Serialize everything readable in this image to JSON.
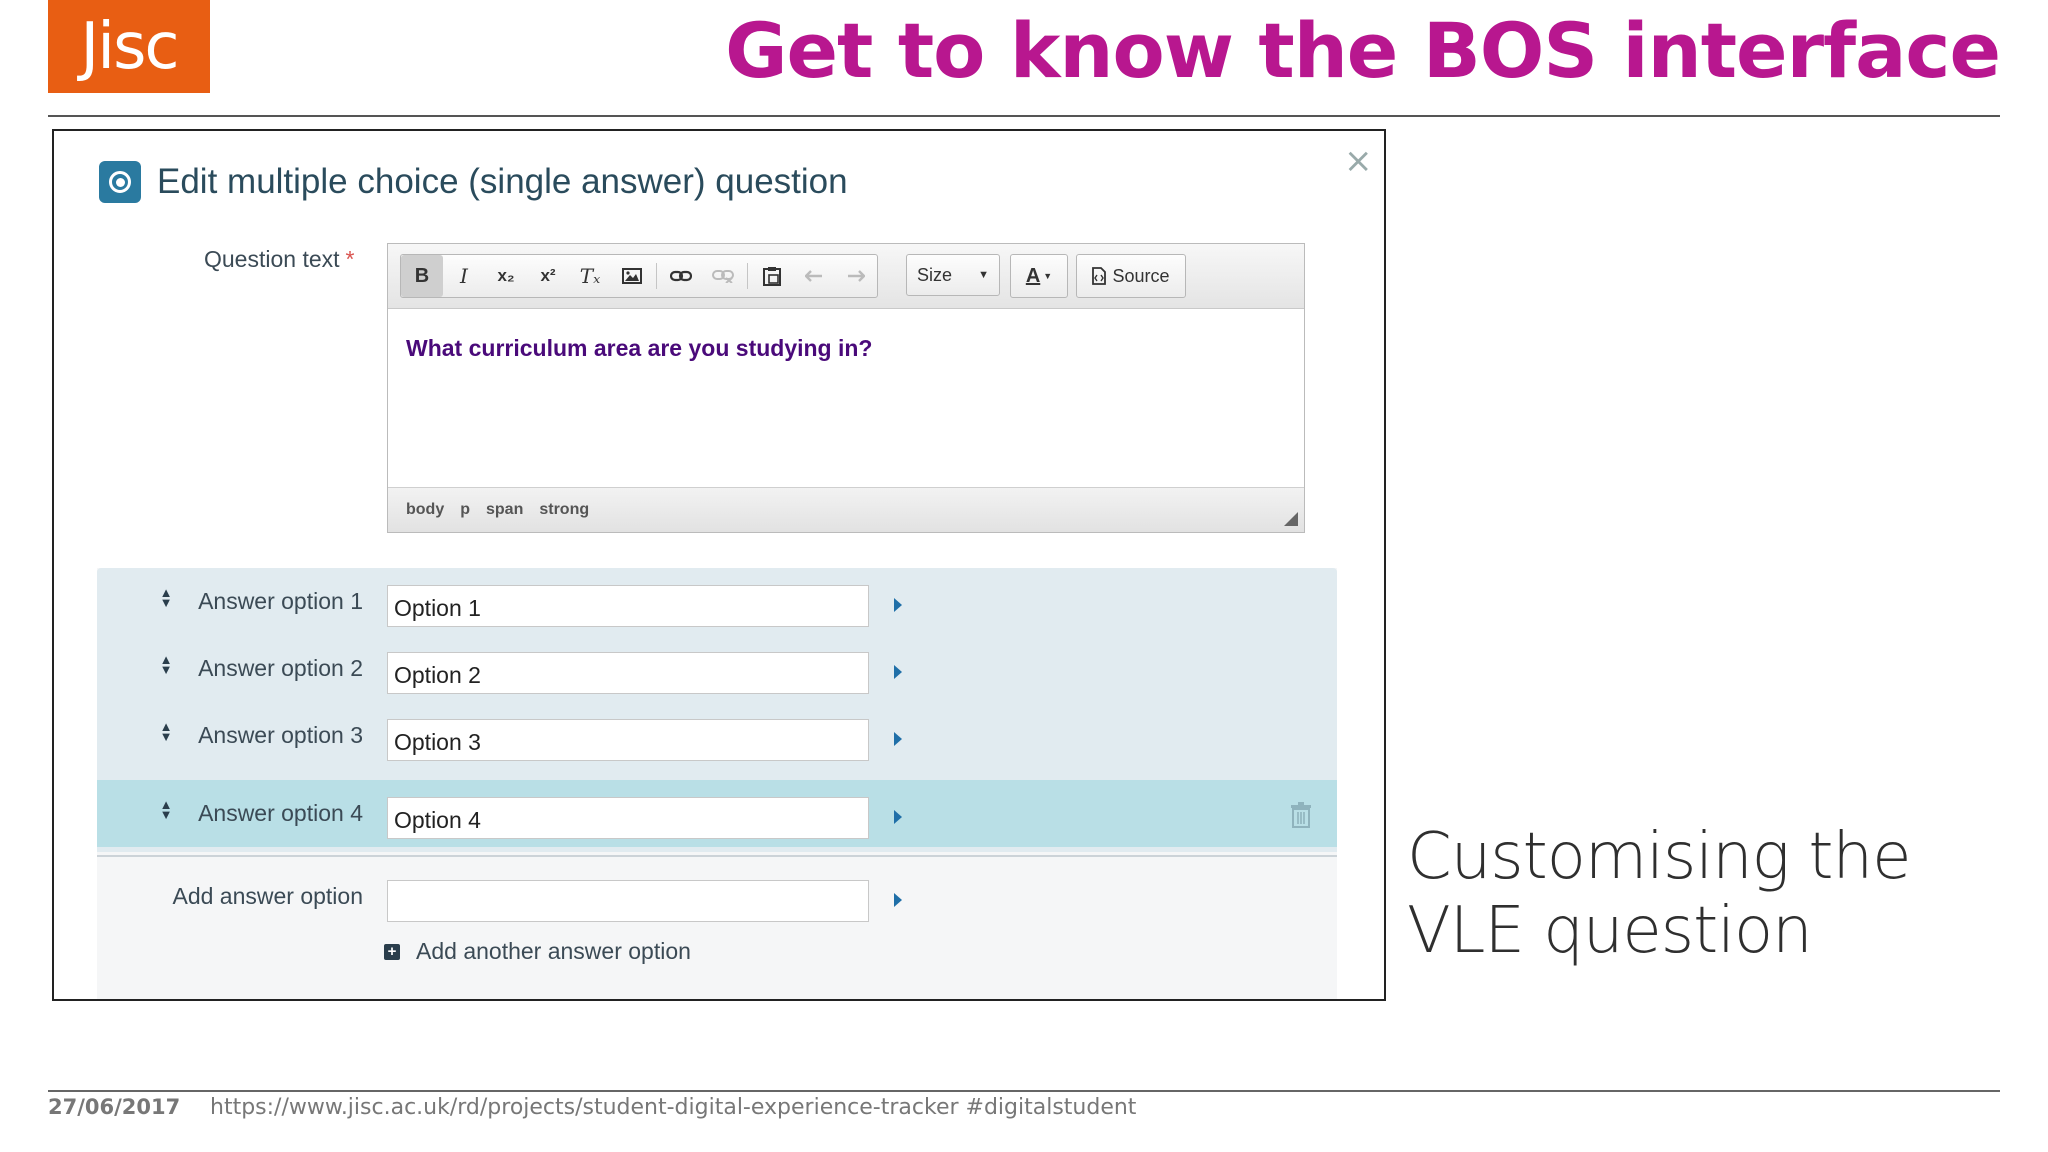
{
  "slide": {
    "logo": "Jisc",
    "title": "Get to know the BOS interface",
    "title_color": "#b8178f",
    "logo_color": "#e85e13",
    "caption": "Customising the VLE question",
    "footer_date": "27/06/2017",
    "footer_link": "https://www.jisc.ac.uk/rd/projects/student-digital-experience-tracker  #digitalstudent"
  },
  "dialog": {
    "title": "Edit multiple choice (single answer) question",
    "icon": "radio-question-icon",
    "icon_color": "#2a7aa0",
    "title_color": "#2a4b5c",
    "close": "×",
    "question_label": "Question text",
    "required_mark": "*",
    "editor": {
      "toolbar": {
        "bold": "B",
        "italic": "I",
        "subscript": "x₂",
        "superscript": "x²",
        "clear_format": "Tₓ",
        "size": "Size",
        "font_color": "A",
        "source": "Source"
      },
      "content": "What curriculum area are you studying in?",
      "content_color": "#4a0a7a",
      "path": [
        "body",
        "p",
        "span",
        "strong"
      ]
    },
    "answers": [
      {
        "label": "Answer option 1",
        "value": "Option 1"
      },
      {
        "label": "Answer option 2",
        "value": "Option 2"
      },
      {
        "label": "Answer option 3",
        "value": "Option 3"
      },
      {
        "label": "Answer option 4",
        "value": "Option 4"
      }
    ],
    "add_option_label": "Add answer option",
    "add_option_value": "",
    "add_another": "Add another answer option"
  }
}
